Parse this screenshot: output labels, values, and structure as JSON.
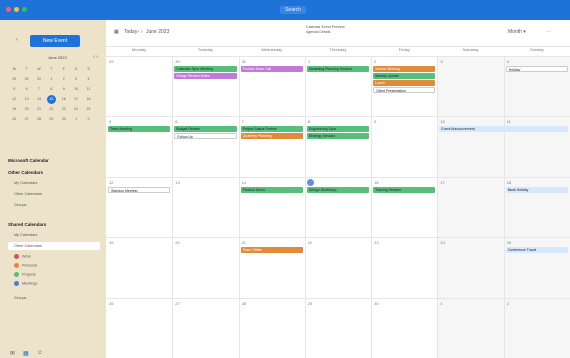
{
  "window": {
    "title": "Search"
  },
  "sidebar": {
    "new_button": "New Event",
    "minical": {
      "month": "June 2023",
      "dows": [
        "M",
        "T",
        "W",
        "T",
        "F",
        "S",
        "S"
      ],
      "days": [
        "29",
        "30",
        "31",
        "1",
        "2",
        "3",
        "4",
        "5",
        "6",
        "7",
        "8",
        "9",
        "10",
        "11",
        "12",
        "13",
        "14",
        "15",
        "16",
        "17",
        "18",
        "19",
        "20",
        "21",
        "22",
        "23",
        "24",
        "25",
        "26",
        "27",
        "28",
        "29",
        "30",
        "1",
        "2"
      ]
    },
    "sections": [
      {
        "title": "Microsoft Calendar",
        "items": []
      },
      {
        "title": "Other Calendars",
        "items": [
          "My Calendars",
          "Other Calendars",
          "Groups"
        ]
      },
      {
        "title": "Shared Calendars",
        "items": [
          "My Calendars",
          "Other Calendars"
        ]
      }
    ],
    "calendars": [
      {
        "label": "Work",
        "color": "#d9534f"
      },
      {
        "label": "Personal",
        "color": "#e18a3a"
      },
      {
        "label": "Projects",
        "color": "#56c07b"
      },
      {
        "label": "Meetings",
        "color": "#4a7be0"
      }
    ],
    "groups_label": "Groups"
  },
  "toolbar": {
    "today": "Today",
    "month_label": "June 2023",
    "center_line1": "Calendar Event Preview",
    "center_line2": "Agenda Details",
    "view": "Month"
  },
  "headers": [
    "Monday",
    "Tuesday",
    "Wednesday",
    "Thursday",
    "Friday",
    "Saturday",
    "Sunday"
  ],
  "weeks": [
    {
      "days": [
        "29",
        "30",
        "31",
        "1",
        "2",
        "3",
        "4"
      ]
    },
    {
      "days": [
        "5",
        "6",
        "7",
        "8",
        "9",
        "10",
        "11"
      ]
    },
    {
      "days": [
        "12",
        "13",
        "14",
        "15",
        "16",
        "17",
        "18"
      ]
    },
    {
      "days": [
        "19",
        "20",
        "21",
        "22",
        "23",
        "24",
        "25"
      ]
    },
    {
      "days": [
        "26",
        "27",
        "28",
        "29",
        "30",
        "1",
        "2"
      ]
    }
  ],
  "events": [
    {
      "text": "Calendar Sync Meeting",
      "color": "g"
    },
    {
      "text": "Design Review Notes",
      "color": "p"
    },
    {
      "text": "Product Team Call",
      "color": "p"
    },
    {
      "text": "Marketing Planning Session",
      "color": "g"
    },
    {
      "text": "Vendor Meeting",
      "color": "o"
    },
    {
      "text": "Weekly Update",
      "color": "g"
    },
    {
      "text": "Lunch",
      "color": "o"
    },
    {
      "text": "Client Presentation",
      "color": "w"
    },
    {
      "text": "Holiday",
      "color": "w"
    },
    {
      "text": "Team Meeting",
      "color": "g"
    },
    {
      "text": "Budget Review",
      "color": "g"
    },
    {
      "text": "Project Status Review",
      "color": "g"
    },
    {
      "text": "Engineering Sync",
      "color": "g"
    },
    {
      "text": "Follow Up",
      "color": "w"
    },
    {
      "text": "Quarterly Planning",
      "color": "o"
    },
    {
      "text": "Strategy Session",
      "color": "g"
    },
    {
      "text": "Event Announcement",
      "color": "b"
    },
    {
      "text": "Standup Meeting",
      "color": "w"
    },
    {
      "text": "Product Demo",
      "color": "g"
    },
    {
      "text": "Design Workshop",
      "color": "g"
    },
    {
      "text": "Training Session",
      "color": "g"
    },
    {
      "text": "Bank Holiday",
      "color": "b"
    },
    {
      "text": "Team Offsite",
      "color": "o"
    },
    {
      "text": "Conference Travel",
      "color": "b"
    }
  ]
}
